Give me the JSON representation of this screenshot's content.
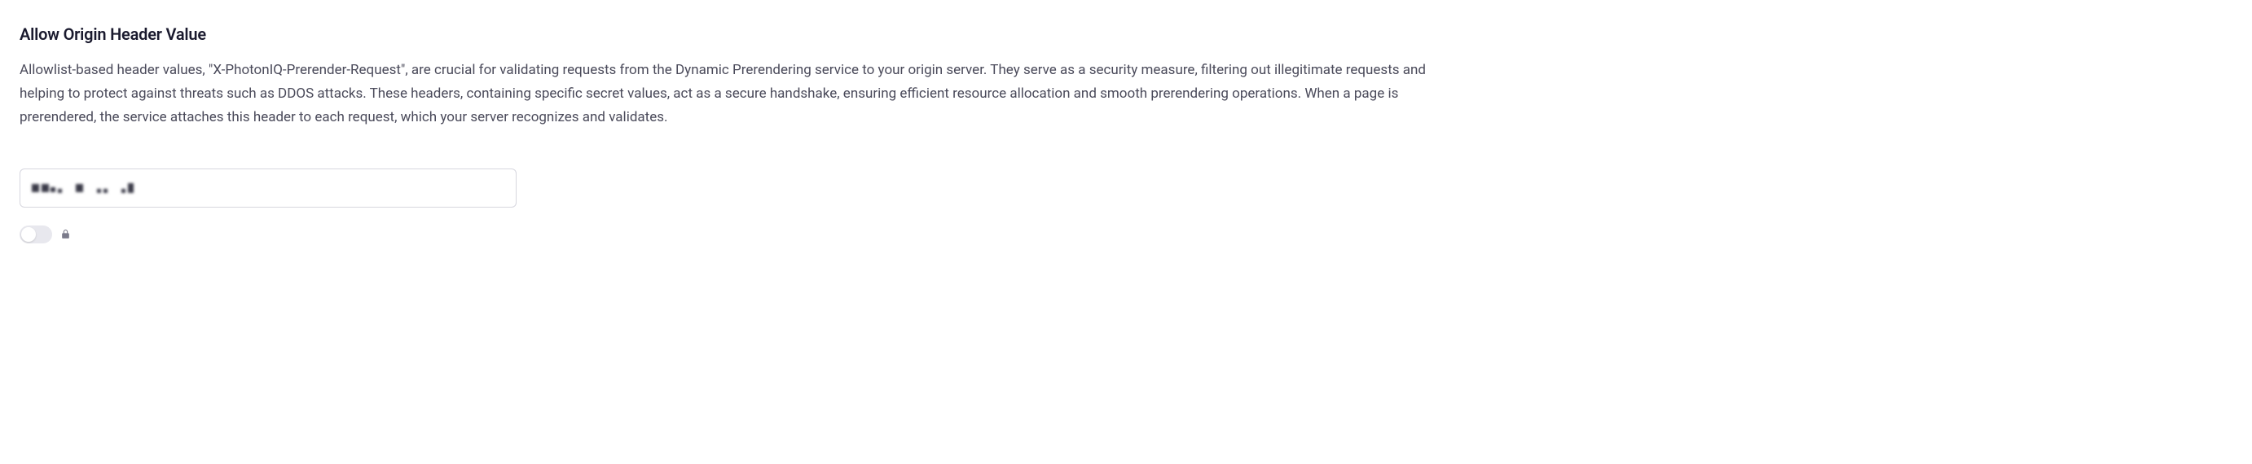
{
  "section": {
    "title": "Allow Origin Header Value",
    "description": "Allowlist-based header values, \"X-PhotonIQ-Prerender-Request\", are crucial for validating requests from the Dynamic Prerendering service to your origin server. They serve as a security measure, filtering out illegitimate requests and helping to protect against threats such as DDOS attacks. These headers, containing specific secret values, act as a secure handshake, ensuring efficient resource allocation and smooth prerendering operations. When a page is prerendered, the service attaches this header to each request, which your server recognizes and validates."
  },
  "input": {
    "value_obscured": true,
    "placeholder": ""
  },
  "toggle": {
    "state": "off",
    "locked": true
  },
  "icons": {
    "lock": "lock-icon"
  }
}
